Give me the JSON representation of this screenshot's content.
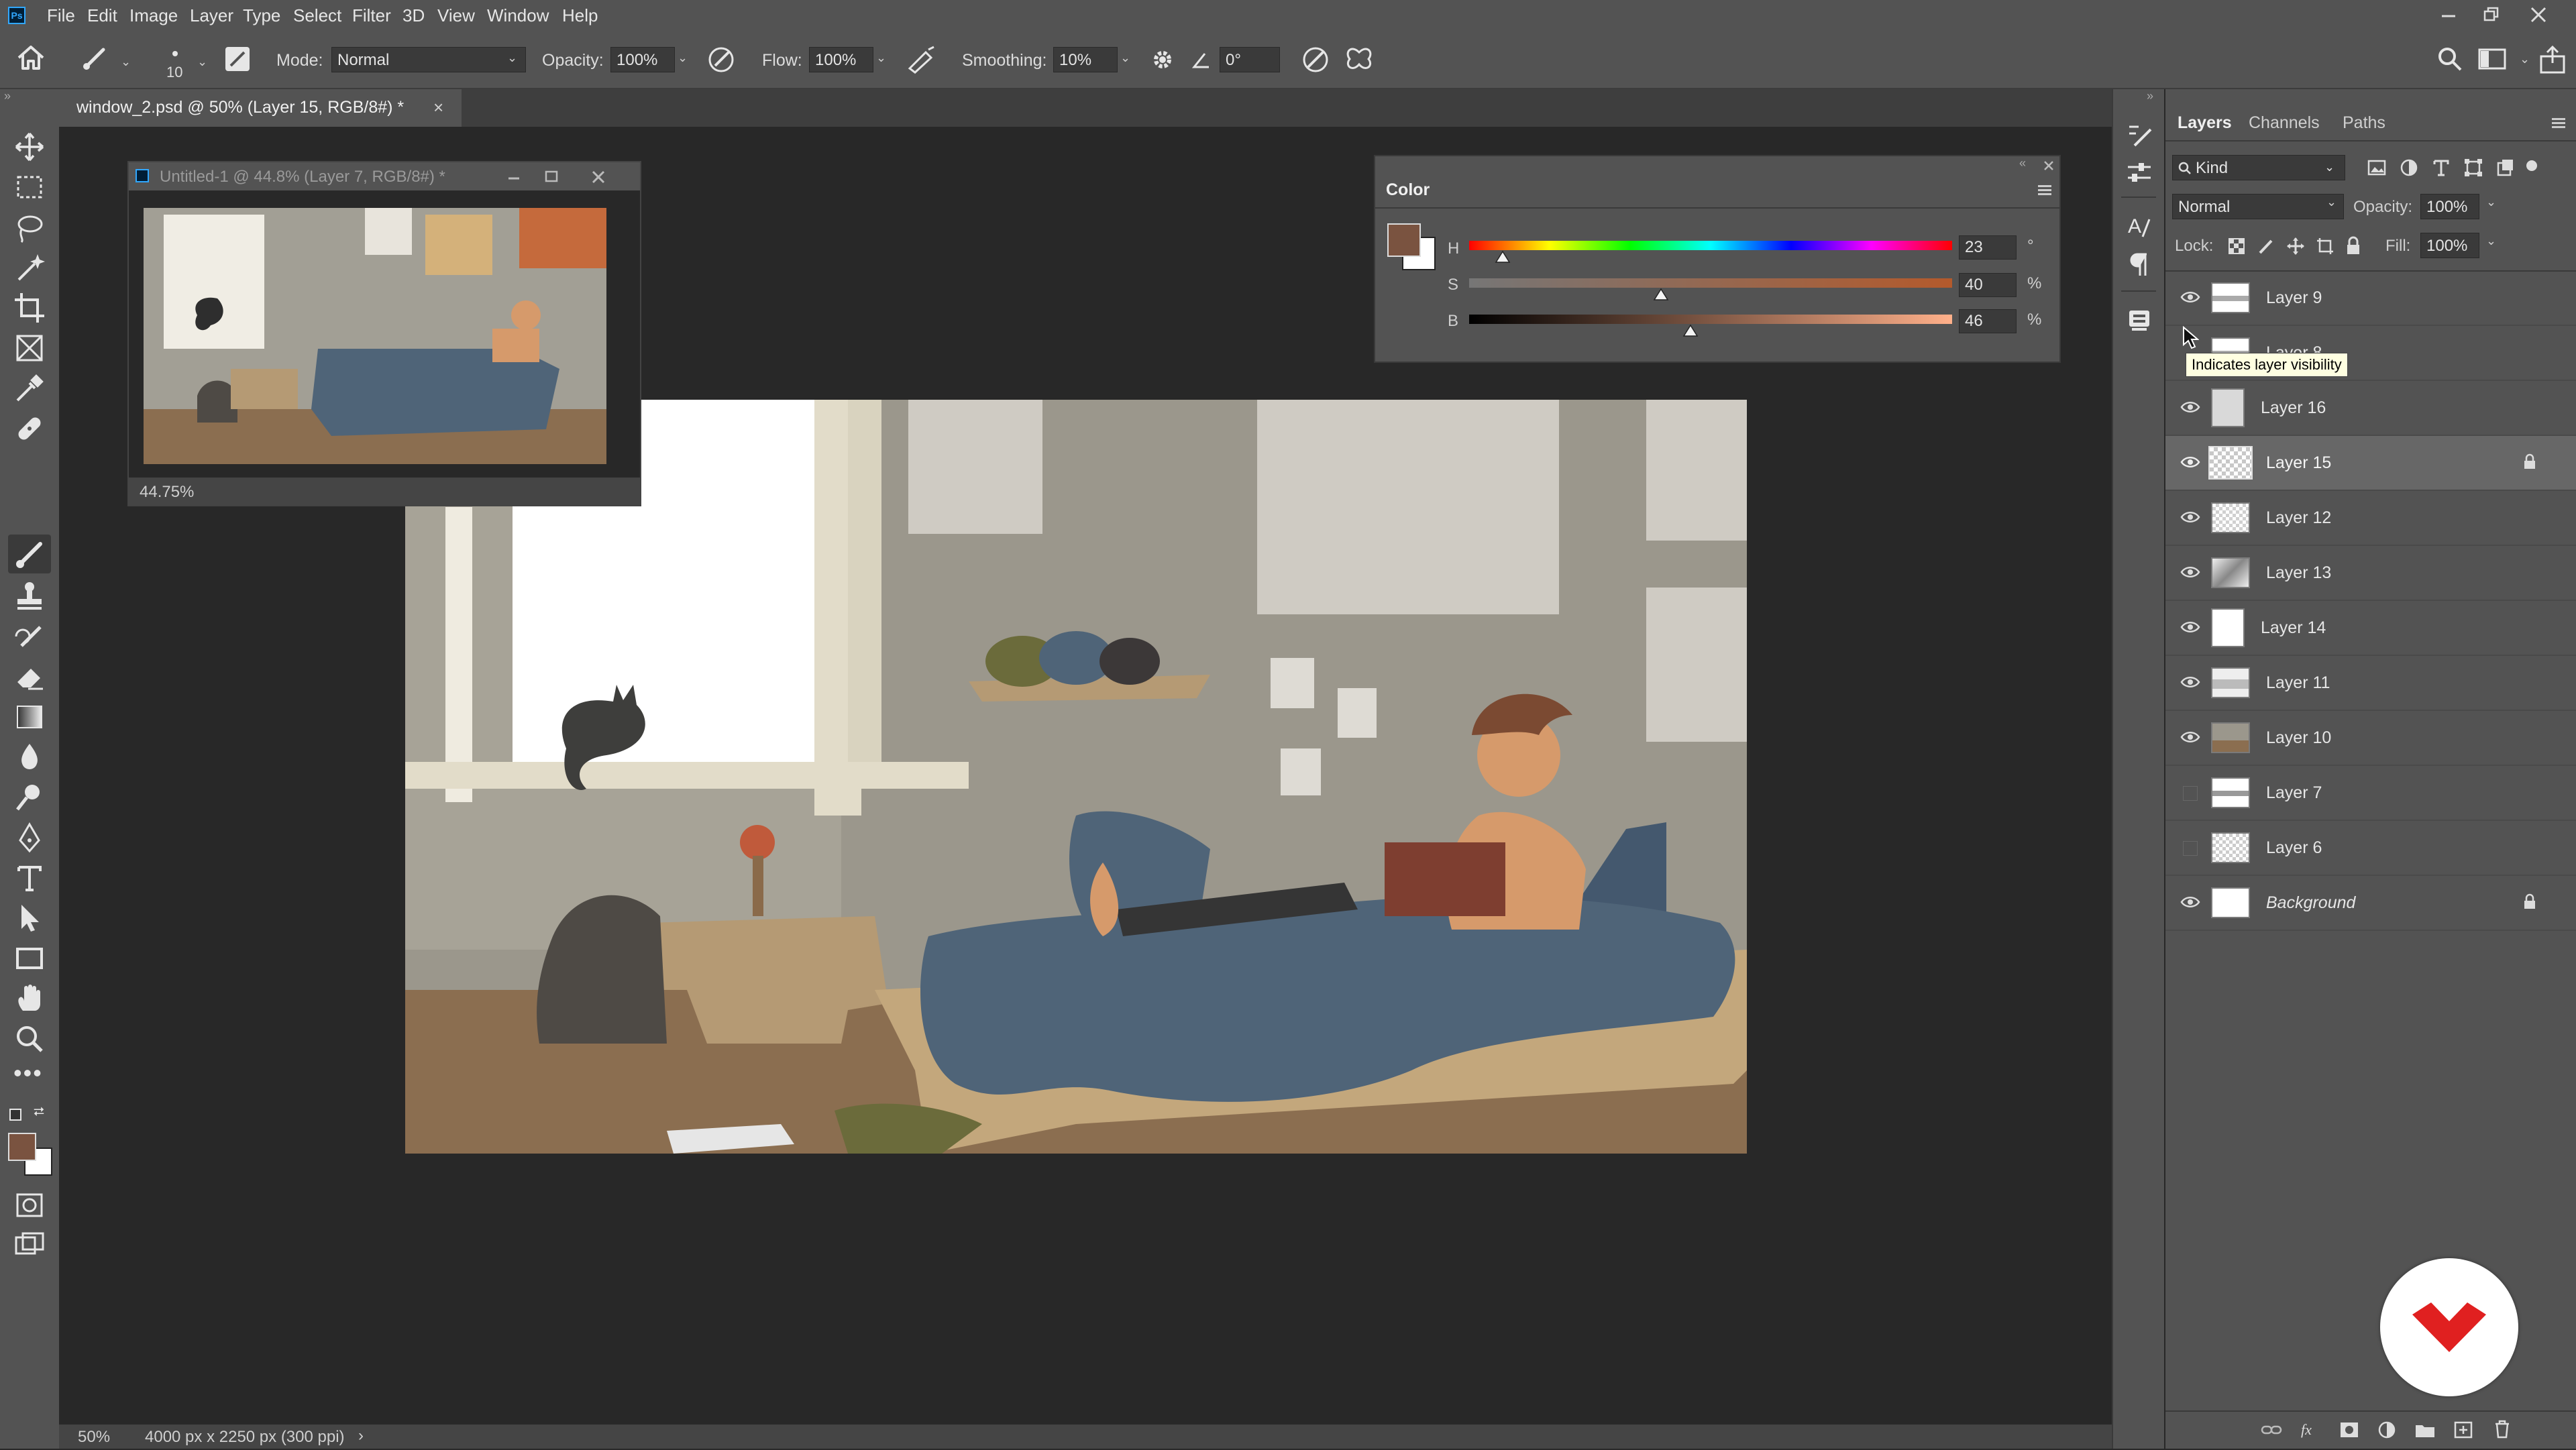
{
  "app_icon": "photoshop-logo",
  "menu": [
    "File",
    "Edit",
    "Image",
    "Layer",
    "Type",
    "Select",
    "Filter",
    "3D",
    "View",
    "Window",
    "Help"
  ],
  "options": {
    "brush_size": "10",
    "mode_label": "Mode:",
    "mode_value": "Normal",
    "opacity_label": "Opacity:",
    "opacity_value": "100%",
    "flow_label": "Flow:",
    "flow_value": "100%",
    "smoothing_label": "Smoothing:",
    "smoothing_value": "10%",
    "angle_value": "0°"
  },
  "document_tab": {
    "title": "window_2.psd @ 50% (Layer 15, RGB/8#) *",
    "close": "×"
  },
  "float_window": {
    "title": "Untitled-1 @ 44.8% (Layer 7, RGB/8#) *",
    "zoom": "44.75%"
  },
  "status": {
    "zoom": "50%",
    "doc_size": "4000 px x 2250 px (300 ppi)",
    "arrow": "›"
  },
  "color_panel": {
    "title": "Color",
    "channels": [
      {
        "label": "H",
        "value": "23",
        "unit": "°",
        "fraction": 0.064
      },
      {
        "label": "S",
        "value": "40",
        "unit": "%",
        "fraction": 0.4
      },
      {
        "label": "B",
        "value": "46",
        "unit": "%",
        "fraction": 0.46
      }
    ],
    "foreground": "#7a5340",
    "background": "#ffffff"
  },
  "layers_panel": {
    "tabs": [
      "Layers",
      "Channels",
      "Paths"
    ],
    "filter_kind": "Kind",
    "blend_mode": "Normal",
    "opacity_label": "Opacity:",
    "opacity_value": "100%",
    "lock_label": "Lock:",
    "fill_label": "Fill:",
    "fill_value": "100%",
    "tooltip": "Indicates layer visibility",
    "layers": [
      {
        "name": "Layer 9",
        "visible": true,
        "selected": false,
        "locked": false,
        "italic": false
      },
      {
        "name": "Layer 8",
        "visible": true,
        "selected": false,
        "locked": false,
        "italic": false
      },
      {
        "name": "Layer 16",
        "visible": true,
        "selected": false,
        "locked": false,
        "italic": false
      },
      {
        "name": "Layer 15",
        "visible": true,
        "selected": true,
        "locked": true,
        "italic": false
      },
      {
        "name": "Layer 12",
        "visible": true,
        "selected": false,
        "locked": false,
        "italic": false
      },
      {
        "name": "Layer 13",
        "visible": true,
        "selected": false,
        "locked": false,
        "italic": false
      },
      {
        "name": "Layer 14",
        "visible": true,
        "selected": false,
        "locked": false,
        "italic": false
      },
      {
        "name": "Layer 11",
        "visible": true,
        "selected": false,
        "locked": false,
        "italic": false
      },
      {
        "name": "Layer 10",
        "visible": true,
        "selected": false,
        "locked": false,
        "italic": false
      },
      {
        "name": "Layer 7",
        "visible": false,
        "selected": false,
        "locked": false,
        "italic": false
      },
      {
        "name": "Layer 6",
        "visible": false,
        "selected": false,
        "locked": false,
        "italic": false
      },
      {
        "name": "Background",
        "visible": true,
        "selected": false,
        "locked": true,
        "italic": true
      }
    ]
  },
  "colors": {
    "accent_brand": "#e02020",
    "swatch_fg": "#7a5340",
    "swatch_bg": "#ffffff"
  }
}
